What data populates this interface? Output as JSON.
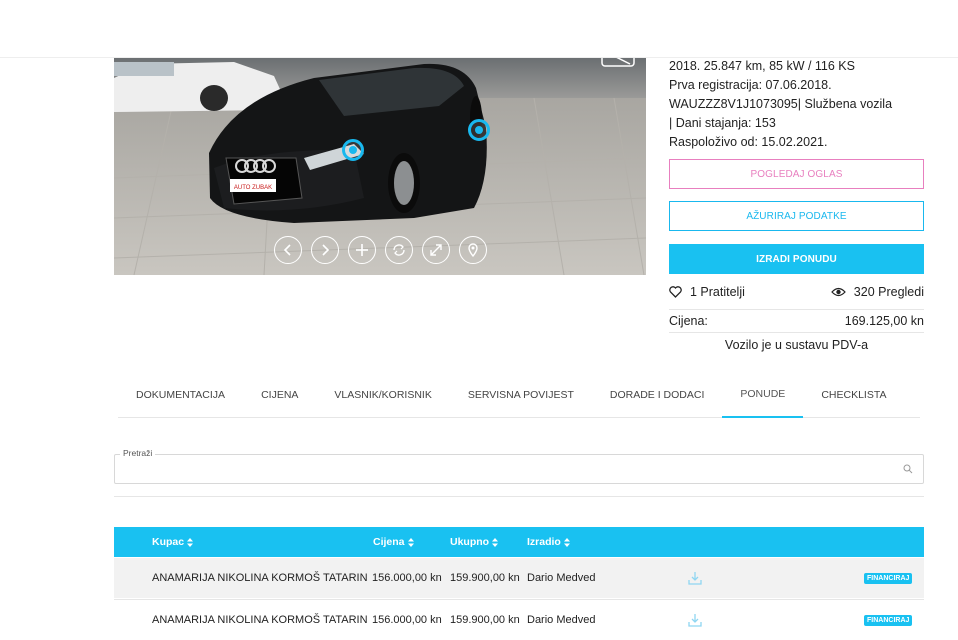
{
  "vehicle": {
    "specs": [
      "2018. 25.847 km, 85 kW / 116 KS",
      "Prva registracija: 07.06.2018.",
      "WAUZZZ8V1J1073095| Službena vozila",
      "| Dani stajanja: 153",
      "Raspoloživo od: 15.02.2021."
    ],
    "followers": "1 Pratitelji",
    "views": "320 Pregledi",
    "price_label": "Cijena:",
    "price_value": "169.125,00 kn",
    "vat_note": "Vozilo je u sustavu PDV-a",
    "plate_text": "AUTO ZUBAK"
  },
  "buttons": {
    "view": "POGLEDAJ OGLAS",
    "update": "AŽURIRAJ PODATKE",
    "offer": "IZRADI PONUDU"
  },
  "tabs": [
    "DOKUMENTACIJA",
    "CIJENA",
    "VLASNIK/KORISNIK",
    "SERVISNA POVIJEST",
    "DORADE I DODACI",
    "PONUDE",
    "CHECKLISTA"
  ],
  "active_tab": "PONUDE",
  "search": {
    "label": "Pretraži",
    "value": "",
    "placeholder": ""
  },
  "table": {
    "headers": {
      "buyer": "Kupac",
      "price": "Cijena",
      "total": "Ukupno",
      "made_by": "Izradio"
    },
    "rows": [
      {
        "buyer": "ANAMARIJA NIKOLINA  KORMOŠ TATARIN",
        "price": "156.000,00 kn",
        "total": "159.900,00 kn",
        "made_by": "Dario Medved",
        "badge": "FINANCIRAJ"
      },
      {
        "buyer": "ANAMARIJA NIKOLINA  KORMOŠ TATARIN",
        "price": "156.000,00 kn",
        "total": "159.900,00 kn",
        "made_by": "Dario Medved",
        "badge": "FINANCIRAJ"
      }
    ]
  },
  "colors": {
    "accent": "#19c1f1",
    "pink": "#e87fbf"
  },
  "icons": {
    "gallery": [
      "chevron-left-icon",
      "chevron-right-icon",
      "plus-icon",
      "rotate-icon",
      "expand-icon",
      "location-pin-icon"
    ],
    "stats": [
      "heart-icon",
      "eye-icon"
    ],
    "table": [
      "download-icon",
      "sort-icon"
    ]
  }
}
